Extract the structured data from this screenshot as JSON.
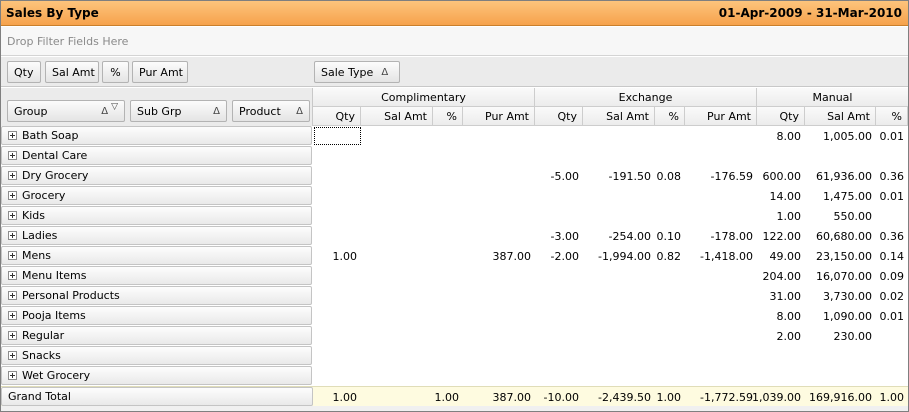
{
  "title": "Sales By Type",
  "date_range": "01-Apr-2009  - 31-Mar-2010",
  "filter_placeholder": "Drop Filter Fields Here",
  "data_fields": [
    {
      "label": "Qty",
      "name": "data-field-qty"
    },
    {
      "label": "Sal Amt",
      "name": "data-field-sal-amt"
    },
    {
      "label": "%",
      "name": "data-field-percent"
    },
    {
      "label": "Pur Amt",
      "name": "data-field-pur-amt"
    }
  ],
  "column_field": {
    "label": "Sale Type",
    "sort": "Δ"
  },
  "row_fields": [
    {
      "label": "Group",
      "sort": "Δ",
      "filter": "▽"
    },
    {
      "label": "Sub Grp",
      "sort": "Δ"
    },
    {
      "label": "Product",
      "sort": "Δ"
    }
  ],
  "column_groups": [
    "Complimentary",
    "Exchange",
    "Manual"
  ],
  "measure_headers": [
    "Qty",
    "Sal Amt",
    "%",
    "Pur Amt",
    "Qty",
    "Sal Amt",
    "%",
    "Pur Amt",
    "Qty",
    "Sal Amt",
    "%"
  ],
  "rows": [
    {
      "label": "Bath Soap",
      "cells": [
        "",
        "",
        "",
        "",
        "",
        "",
        "",
        "",
        "8.00",
        "1,005.00",
        "0.01"
      ]
    },
    {
      "label": "Dental Care",
      "cells": [
        "",
        "",
        "",
        "",
        "",
        "",
        "",
        "",
        "",
        "",
        ""
      ]
    },
    {
      "label": "Dry Grocery",
      "cells": [
        "",
        "",
        "",
        "",
        "-5.00",
        "-191.50",
        "0.08",
        "-176.59",
        "600.00",
        "61,936.00",
        "0.36"
      ]
    },
    {
      "label": "Grocery",
      "cells": [
        "",
        "",
        "",
        "",
        "",
        "",
        "",
        "",
        "14.00",
        "1,475.00",
        "0.01"
      ]
    },
    {
      "label": "Kids",
      "cells": [
        "",
        "",
        "",
        "",
        "",
        "",
        "",
        "",
        "1.00",
        "550.00",
        ""
      ]
    },
    {
      "label": "Ladies",
      "cells": [
        "",
        "",
        "",
        "",
        "-3.00",
        "-254.00",
        "0.10",
        "-178.00",
        "122.00",
        "60,680.00",
        "0.36"
      ]
    },
    {
      "label": "Mens",
      "cells": [
        "1.00",
        "",
        "",
        "387.00",
        "-2.00",
        "-1,994.00",
        "0.82",
        "-1,418.00",
        "49.00",
        "23,150.00",
        "0.14"
      ]
    },
    {
      "label": "Menu Items",
      "cells": [
        "",
        "",
        "",
        "",
        "",
        "",
        "",
        "",
        "204.00",
        "16,070.00",
        "0.09"
      ]
    },
    {
      "label": "Personal Products",
      "cells": [
        "",
        "",
        "",
        "",
        "",
        "",
        "",
        "",
        "31.00",
        "3,730.00",
        "0.02"
      ]
    },
    {
      "label": "Pooja Items",
      "cells": [
        "",
        "",
        "",
        "",
        "",
        "",
        "",
        "",
        "8.00",
        "1,090.00",
        "0.01"
      ]
    },
    {
      "label": "Regular",
      "cells": [
        "",
        "",
        "",
        "",
        "",
        "",
        "",
        "",
        "2.00",
        "230.00",
        ""
      ]
    },
    {
      "label": "Snacks",
      "cells": [
        "",
        "",
        "",
        "",
        "",
        "",
        "",
        "",
        "",
        "",
        ""
      ]
    },
    {
      "label": "Wet Grocery",
      "cells": [
        "",
        "",
        "",
        "",
        "",
        "",
        "",
        "",
        "",
        "",
        ""
      ]
    }
  ],
  "grand_total": {
    "label": "Grand Total",
    "cells": [
      "1.00",
      "",
      "1.00",
      "387.00",
      "-10.00",
      "-2,439.50",
      "1.00",
      "-1,772.59",
      "1,039.00",
      "169,916.00",
      "1.00"
    ]
  },
  "colors": {
    "title_bar": "#f6a24c",
    "grand_total_bg": "#fefbe0"
  }
}
